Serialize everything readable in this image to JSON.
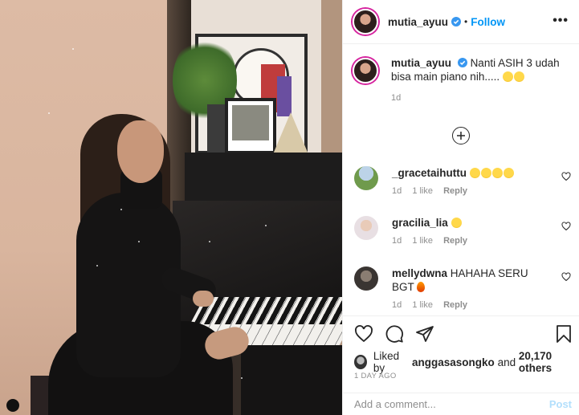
{
  "post": {
    "username": "mutia_ayuu",
    "follow_label": "Follow",
    "more_label": "•••",
    "caption": {
      "username": "mutia_ayuu",
      "text": "Nanti ASIH 3 udah bisa main piano nih.....",
      "time": "1d"
    }
  },
  "comments": [
    {
      "username": "_gracetaihuttu",
      "text": "",
      "time": "1d",
      "likes": "1 like",
      "reply": "Reply"
    },
    {
      "username": "gracilia_lia",
      "text": "",
      "time": "1d",
      "likes": "1 like",
      "reply": "Reply"
    },
    {
      "username": "mellydwna",
      "text": "HAHAHA SERU BGT",
      "time": "1d",
      "likes": "1 like",
      "reply": "Reply"
    }
  ],
  "likes": {
    "prefix": "Liked by",
    "user": "anggasasongko",
    "and": "and",
    "count": "20,170 others"
  },
  "posted_ago": "1 DAY AGO",
  "add_comment": {
    "placeholder": "Add a comment...",
    "post_label": "Post"
  },
  "icons": {
    "verified": "verified-badge-icon",
    "load_more": "plus-circle-icon",
    "like": "heart-icon",
    "comment": "comment-icon",
    "share": "paper-plane-icon",
    "save": "bookmark-icon"
  },
  "colors": {
    "link_blue": "#0095f6",
    "muted": "#8e8e8e",
    "post_disabled": "#b2dffc"
  }
}
